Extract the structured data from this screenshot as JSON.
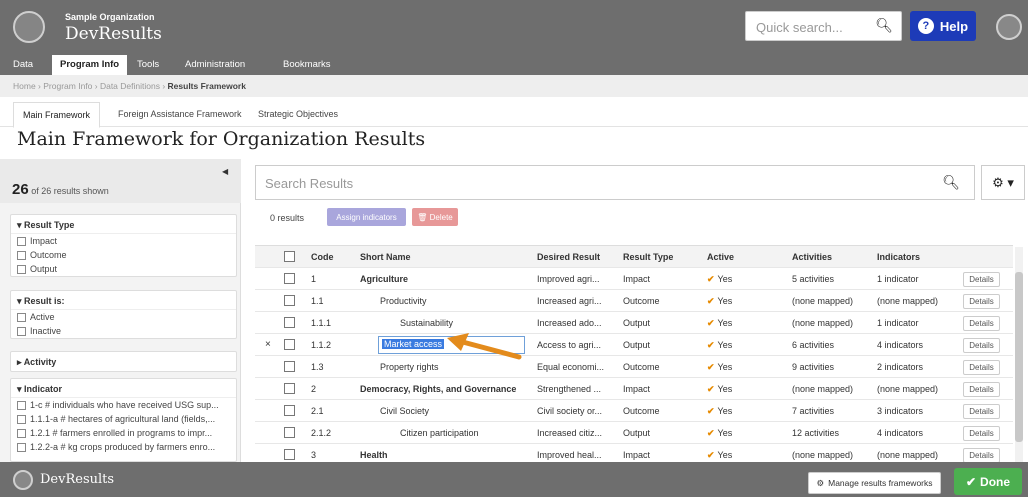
{
  "header": {
    "org_name": "Sample Organization",
    "app_name": "DevResults",
    "search_placeholder": "Quick search...",
    "help_label": "Help"
  },
  "nav": {
    "items": [
      "Data",
      "Program Info",
      "Tools",
      "Administration",
      "Bookmarks"
    ],
    "active": "Program Info"
  },
  "breadcrumb": {
    "items": [
      "Home",
      "Program Info",
      "Data Definitions"
    ],
    "current": "Results Framework"
  },
  "subtabs": [
    "Main Framework",
    "Foreign Assistance Framework",
    "Strategic Objectives"
  ],
  "page_title": "Main Framework for Organization Results",
  "sidebar": {
    "count_shown": "26",
    "count_text": "of 26 results shown",
    "facets": [
      {
        "title": "Result Type",
        "expanded": true,
        "items": [
          "Impact",
          "Outcome",
          "Output"
        ]
      },
      {
        "title": "Result is:",
        "expanded": true,
        "items": [
          "Active",
          "Inactive"
        ]
      },
      {
        "title": "Activity",
        "expanded": false,
        "items": []
      },
      {
        "title": "Indicator",
        "expanded": true,
        "items": [
          "1-c # individuals who have received USG sup...",
          "1.1.1-a # hectares of agricultural land (fields,...",
          "1.2.1 # farmers enrolled in programs to impr...",
          "1.2.2-a # kg crops produced by farmers enro..."
        ]
      }
    ]
  },
  "results": {
    "search_placeholder": "Search Results",
    "count": "0 results",
    "assign_label": "Assign indicators",
    "delete_label": "Delete",
    "columns": [
      "Code",
      "Short Name",
      "Desired Result",
      "Result Type",
      "Active",
      "Activities",
      "Indicators"
    ],
    "rows": [
      {
        "code": "1",
        "name": "Agriculture",
        "indent": 0,
        "bold": true,
        "desired": "Improved agri...",
        "type": "Impact",
        "active": "Yes",
        "activities": "5 activities",
        "indicators": "1 indicator"
      },
      {
        "code": "1.1",
        "name": "Productivity",
        "indent": 1,
        "bold": false,
        "desired": "Increased agri...",
        "type": "Outcome",
        "active": "Yes",
        "activities": "(none mapped)",
        "indicators": "(none mapped)"
      },
      {
        "code": "1.1.1",
        "name": "Sustainability",
        "indent": 2,
        "bold": false,
        "desired": "Increased ado...",
        "type": "Output",
        "active": "Yes",
        "activities": "(none mapped)",
        "indicators": "1 indicator"
      },
      {
        "code": "1.1.2",
        "name": "Market access",
        "indent": 2,
        "bold": false,
        "editing": true,
        "desired": "Access to agri...",
        "type": "Output",
        "active": "Yes",
        "activities": "6 activities",
        "indicators": "4 indicators"
      },
      {
        "code": "1.3",
        "name": "Property rights",
        "indent": 1,
        "bold": false,
        "desired": "Equal economi...",
        "type": "Outcome",
        "active": "Yes",
        "activities": "9 activities",
        "indicators": "2 indicators"
      },
      {
        "code": "2",
        "name": "Democracy, Rights, and Governance",
        "indent": 0,
        "bold": true,
        "desired": "Strengthened ...",
        "type": "Impact",
        "active": "Yes",
        "activities": "(none mapped)",
        "indicators": "(none mapped)"
      },
      {
        "code": "2.1",
        "name": "Civil Society",
        "indent": 1,
        "bold": false,
        "desired": "Civil society or...",
        "type": "Outcome",
        "active": "Yes",
        "activities": "7 activities",
        "indicators": "3 indicators"
      },
      {
        "code": "2.1.2",
        "name": "Citizen participation",
        "indent": 2,
        "bold": false,
        "desired": "Increased citiz...",
        "type": "Output",
        "active": "Yes",
        "activities": "12 activities",
        "indicators": "4 indicators"
      },
      {
        "code": "3",
        "name": "Health",
        "indent": 0,
        "bold": true,
        "desired": "Improved heal...",
        "type": "Impact",
        "active": "Yes",
        "activities": "(none mapped)",
        "indicators": "(none mapped)"
      }
    ],
    "details_label": "Details",
    "remove_glyph": "×"
  },
  "footer": {
    "app_name": "DevResults",
    "manage_label": "Manage results frameworks",
    "done_label": "Done"
  },
  "colors": {
    "topbar": "#6e6e6e",
    "help": "#1d3bb8",
    "done": "#4caf50",
    "check": "#e68a00",
    "highlight": "#3a7be0",
    "arrow": "#e38b1c"
  }
}
